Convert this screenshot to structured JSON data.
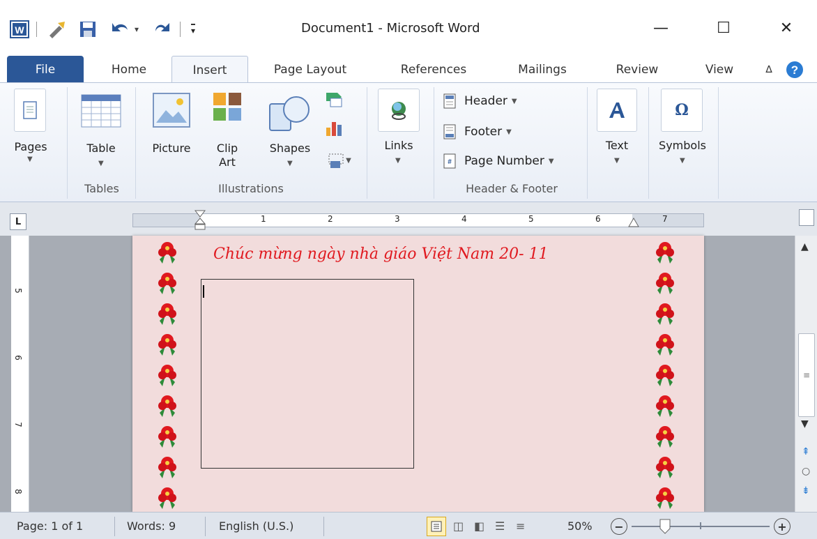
{
  "window": {
    "title": "Document1 - Microsoft Word",
    "minimize_glyph": "—",
    "maximize_glyph": "☐",
    "close_glyph": "✕"
  },
  "quick_access": {
    "customize_glyph": "▾"
  },
  "tabs": [
    {
      "label": "File"
    },
    {
      "label": "Home"
    },
    {
      "label": "Insert"
    },
    {
      "label": "Page Layout"
    },
    {
      "label": "References"
    },
    {
      "label": "Mailings"
    },
    {
      "label": "Review"
    },
    {
      "label": "View"
    }
  ],
  "ribbon": {
    "pages": {
      "label": "Pages"
    },
    "tables": {
      "table_label": "Table",
      "group": "Tables"
    },
    "illustrations": {
      "picture": "Picture",
      "clip_art_1": "Clip",
      "clip_art_2": "Art",
      "shapes": "Shapes",
      "group": "Illustrations"
    },
    "links": {
      "label": "Links"
    },
    "header_footer": {
      "header": "Header",
      "footer": "Footer",
      "page_number": "Page Number",
      "group": "Header & Footer"
    },
    "text": {
      "label": "Text"
    },
    "symbols": {
      "label": "Symbols",
      "omega": "Ω"
    }
  },
  "ruler": {
    "tab_selector": "L",
    "h_numbers": [
      "1",
      "2",
      "3",
      "4",
      "5",
      "6",
      "7"
    ],
    "v_numbers": [
      "5",
      "6",
      "7",
      "8"
    ]
  },
  "document": {
    "heading": "Chúc mừng ngày nhà giáo Việt Nam 20- 11"
  },
  "status": {
    "page": "Page: 1 of 1",
    "words": "Words: 9",
    "language": "English (U.S.)",
    "zoom": "50%",
    "zoom_out": "−",
    "zoom_in": "+"
  },
  "colors": {
    "file_tab": "#2b5797",
    "page_bg": "#f2dcdc",
    "heading_red": "#e0191f"
  }
}
